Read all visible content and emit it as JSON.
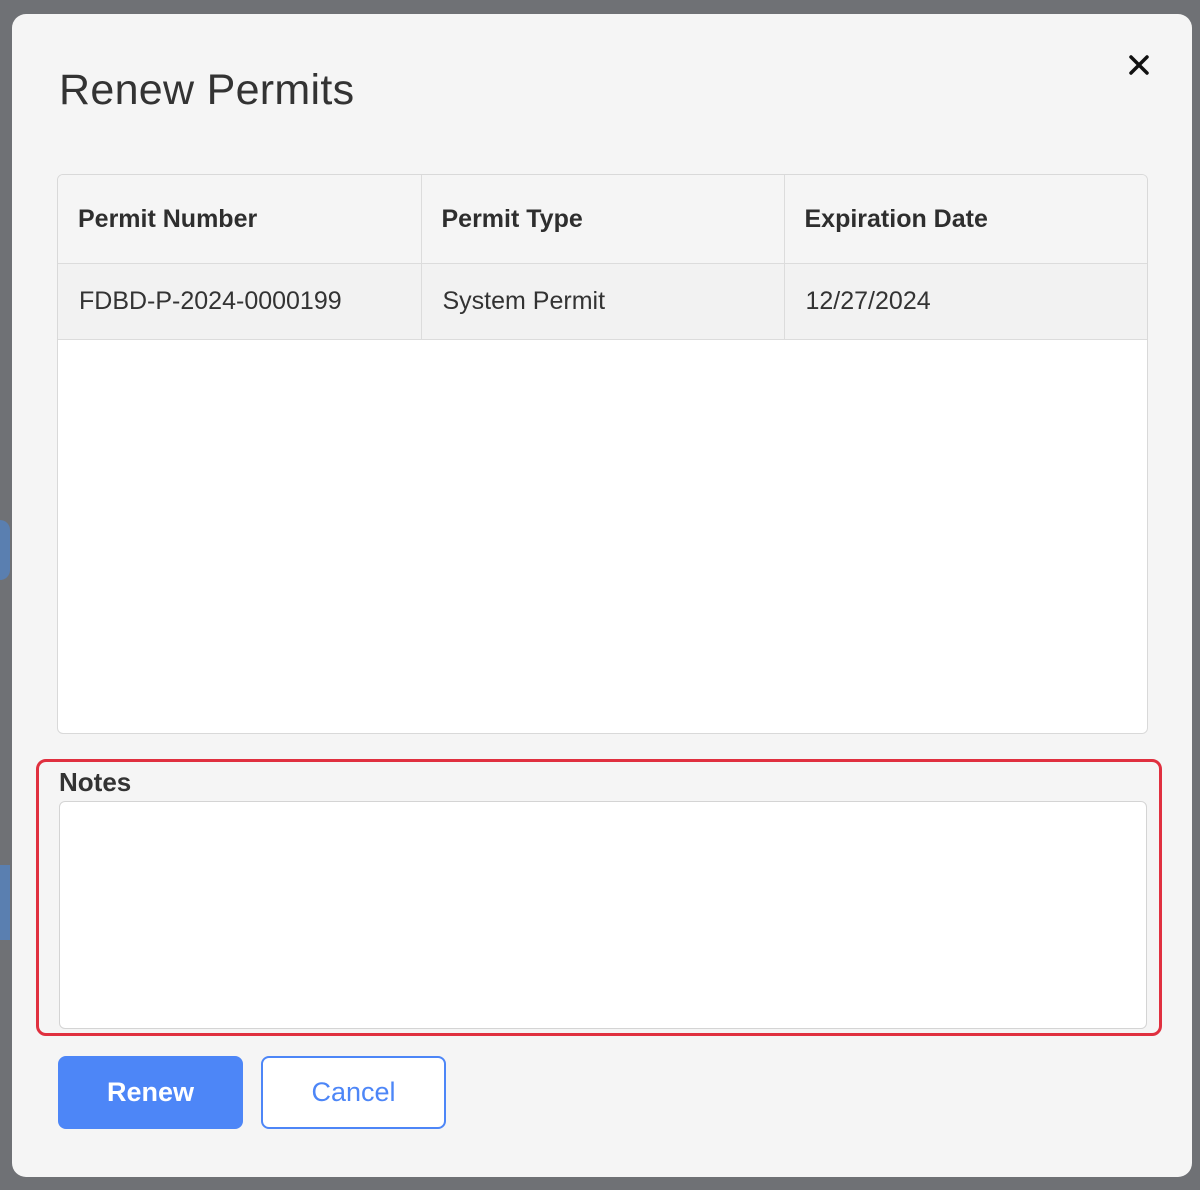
{
  "dialog": {
    "title": "Renew Permits",
    "close_icon": "close-icon"
  },
  "table": {
    "columns": [
      "Permit Number",
      "Permit Type",
      "Expiration Date"
    ],
    "rows": [
      [
        "FDBD-P-2024-0000199",
        "System Permit",
        "12/27/2024"
      ]
    ]
  },
  "notes": {
    "label": "Notes",
    "value": ""
  },
  "actions": {
    "renew_label": "Renew",
    "cancel_label": "Cancel"
  },
  "colors": {
    "accent": "#4d86f7",
    "highlight": "#e0303f"
  }
}
